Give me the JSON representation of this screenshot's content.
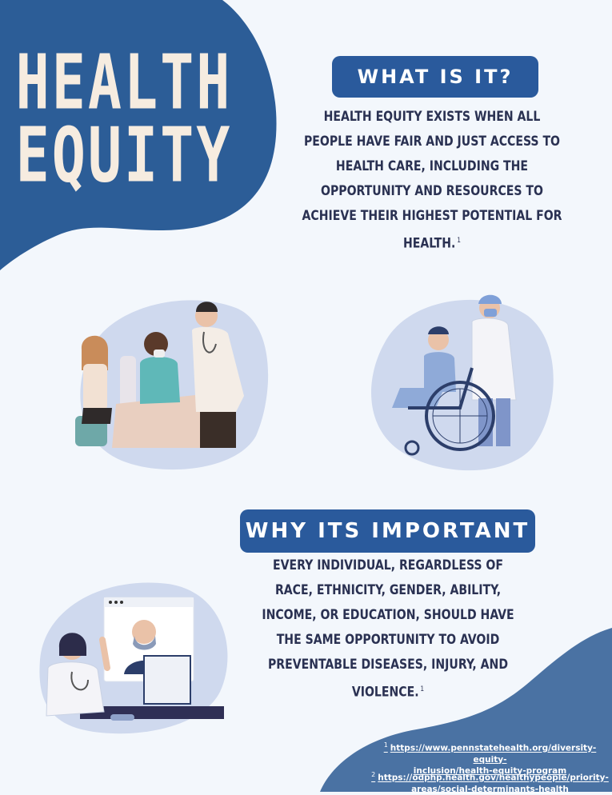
{
  "title": {
    "line1": "HEALTH",
    "line2": "EQUITY"
  },
  "what": {
    "heading": "WHAT IS IT?",
    "lines": [
      "HEALTH EQUITY EXISTS WHEN ALL",
      "PEOPLE HAVE FAIR AND JUST ACCESS TO",
      "HEALTH CARE, INCLUDING THE",
      "OPPORTUNITY AND RESOURCES TO",
      "ACHIEVE THEIR HIGHEST POTENTIAL FOR",
      "HEALTH."
    ],
    "footnote_mark": "1"
  },
  "why": {
    "heading": "WHY ITS IMPORTANT",
    "lines": [
      "EVERY INDIVIDUAL, REGARDLESS OF",
      "RACE, ETHNICITY, GENDER, ABILITY,",
      "INCOME, OR EDUCATION, SHOULD HAVE",
      "THE SAME OPPORTUNITY TO AVOID",
      "PREVENTABLE DISEASES, INJURY, AND",
      "VIOLENCE."
    ],
    "footnote_mark": "1"
  },
  "references": [
    {
      "num": "1",
      "line1": "https://www.pennstatehealth.org/diversity-equity-",
      "line2": "inclusion/health-equity-program"
    },
    {
      "num": "2",
      "line1": "https://odphp.health.gov/healthypeople/priority-",
      "line2": "areas/social-determinants-health"
    }
  ],
  "colors": {
    "background": "#f3f7fc",
    "navy_blob": "#2c5d97",
    "pill": "#2a5a9c",
    "text": "#2a3152",
    "title_text": "#f6ece0",
    "illustration_blob": "#cfd9ee",
    "corner_blob": "#4a72a3"
  },
  "icons": [
    "hospital-bed-patient-doctor-illustration",
    "wheelchair-patient-nurse-illustration",
    "telehealth-video-call-illustration"
  ]
}
